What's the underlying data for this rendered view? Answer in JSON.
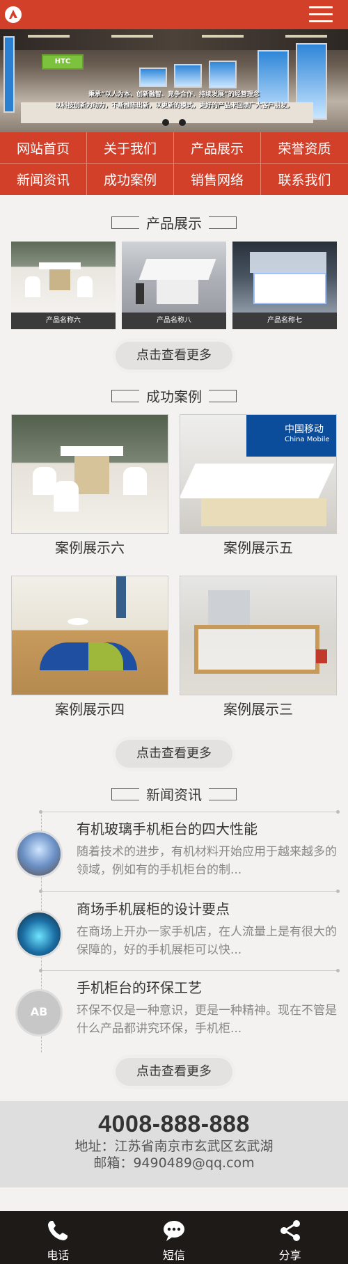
{
  "header": {
    "menu_icon": "hamburger-menu-icon",
    "logo_icon": "logo-icon"
  },
  "banner": {
    "slogan_line1": "秉承“以人为本、创新融智、竞争合作、持续发展”的经营理念",
    "slogan_line2": "以科技创新为动力，不断推陈出新，以更新的模式，更好的产品来回馈广大客户朋友。",
    "brand_text": "HTC"
  },
  "nav": [
    {
      "label": "网站首页"
    },
    {
      "label": "关于我们"
    },
    {
      "label": "产品展示"
    },
    {
      "label": "荣誉资质"
    },
    {
      "label": "新闻资讯"
    },
    {
      "label": "成功案例"
    },
    {
      "label": "销售网络"
    },
    {
      "label": "联系我们"
    }
  ],
  "products": {
    "title": "产品展示",
    "items": [
      {
        "caption": "产品名称六"
      },
      {
        "caption": "产品名称八"
      },
      {
        "caption": "产品名称七"
      }
    ],
    "more": "点击查看更多"
  },
  "cases": {
    "title": "成功案例",
    "items": [
      {
        "label": "案例展示六"
      },
      {
        "label": "案例展示五"
      },
      {
        "label": "案例展示四"
      },
      {
        "label": "案例展示三"
      }
    ],
    "more": "点击查看更多",
    "sign_cn": "中国移动",
    "sign_en": "China Mobile"
  },
  "news": {
    "title": "新闻资讯",
    "items": [
      {
        "title": "有机玻璃手机柜台的四大性能",
        "desc": "随着技术的进步，有机材料开始应用于越来越多的领域，例如有的手机柜台的制..."
      },
      {
        "title": "商场手机展柜的设计要点",
        "desc": "在商场上开办一家手机店，在人流量上是有很大的保障的，好的手机展柜可以快..."
      },
      {
        "title": "手机柜台的环保工艺",
        "desc": "环保不仅是一种意识，更是一种精神。现在不管是什么产品都讲究环保，手机柜..."
      }
    ],
    "thumb3_text": "AB",
    "more": "点击查看更多"
  },
  "contact": {
    "phone": "4008-888-888",
    "address": "地址：江苏省南京市玄武区玄武湖",
    "email": "邮箱：9490489@qq.com"
  },
  "footer": [
    {
      "label": "电话",
      "icon": "phone-icon"
    },
    {
      "label": "短信",
      "icon": "sms-icon"
    },
    {
      "label": "分享",
      "icon": "share-icon"
    }
  ],
  "colors": {
    "brand": "#d2402a",
    "footer_bg": "#1e1a18",
    "contact_bg": "#dedede"
  }
}
